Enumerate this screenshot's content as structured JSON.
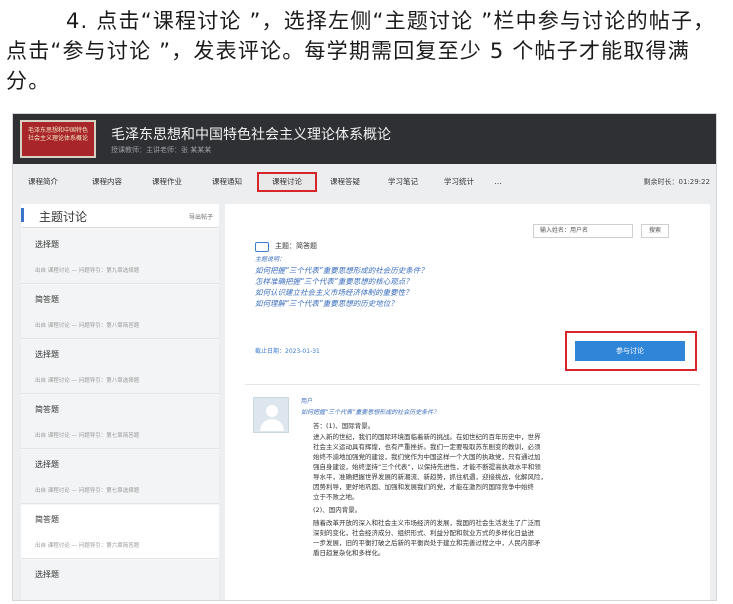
{
  "instruction": "4.  点击“课程讨论 ”，选择左侧“主题讨论 ”栏中参与讨论的帖子，点击“参与讨论 ”，发表评论。每学期需回复至少 5 个帖子才能取得满分。",
  "header": {
    "logo_text": "毛泽东思想和中国特色社会主义理论体系概论",
    "title": "毛泽东思想和中国特色社会主义理论体系概论",
    "subtitle": "授课教师：主讲老师：张 某某某"
  },
  "nav": {
    "tabs": [
      "课程简介",
      "课程内容",
      "课程作业",
      "课程通知",
      "课程讨论",
      "课程答疑",
      "学习笔记",
      "学习统计",
      "…"
    ],
    "highlighted_tab": "课程讨论",
    "right_text": "剩余时长：01:29:22"
  },
  "sidebar": {
    "title": "主题讨论",
    "link": "导出帖子",
    "items": [
      {
        "title": "选择题",
        "source": "出自 课程讨论 — 问题导引：第九章选择题"
      },
      {
        "title": "简答题",
        "source": "出自 课程讨论 — 问题导引：第八章简答题"
      },
      {
        "title": "选择题",
        "source": "出自 课程讨论 — 问题导引：第八章选择题"
      },
      {
        "title": "简答题",
        "source": "出自 课程讨论 — 问题导引：第七章简答题"
      },
      {
        "title": "选择题",
        "source": "出自 课程讨论 — 问题导引：第七章选择题"
      },
      {
        "title": "简答题",
        "source": "出自 课程讨论 — 问题导引：第六章简答题"
      },
      {
        "title": "选择题",
        "source": ""
      }
    ]
  },
  "main": {
    "search_placeholder": "输入姓名：用户名",
    "search_button": "搜索",
    "topic_label": "主题：简答题",
    "desc_label": "主题说明：",
    "questions": [
      "如何把握“三个代表”重要思想形成的社会历史条件？",
      "怎样准确把握“三个代表”重要思想的核心观点？",
      "如何认识建立社会主义市场经济体制的重要性？",
      "如何理解“三个代表”重要思想的历史地位？"
    ],
    "date": "截止日期：2023-01-31",
    "join_button": "参与讨论",
    "reply": {
      "user": "用户",
      "question": "如何把握“三个代表”重要思想形成的社会历史条件？",
      "lines": [
        "答：(1)、国际背景。",
        "进入新的世纪，我们的国际环境面临着新的挑战。在如世纪的百年历史中，世界",
        "社会主义运动具有辉煌，也有严重挫折。我们一定要吸取苏东剧变的教训，必须",
        "始终不渝地加强党的建设，我们党作为中国这样一个大国的执政党，只有通过加",
        "强自身建设，始终坚持“三个代表”，以保持先进性，才能不断提高执政水平和领",
        "导水平，准确把握世界发展的新潮流、新趋势，抓住机遇，迎接挑战，化解风险，",
        "因势利导，更好地巩固、加强和发展我们的党，才能在激烈的国际竞争中始终",
        "立于不败之地。",
        "(2)、国内背景。",
        "随着改革开放的深入和社会主义市场经济的发展，我国的社会生活发生了广泛而",
        "深刻的变化，社会经济成分、组织形式、利益分配和就业方式的多样化日益进",
        "一步发展，旧的平衡打破之后新的平衡尚处于建立和完善过程之中，人民内部矛",
        "盾日趋复杂化和多样化。"
      ]
    }
  }
}
